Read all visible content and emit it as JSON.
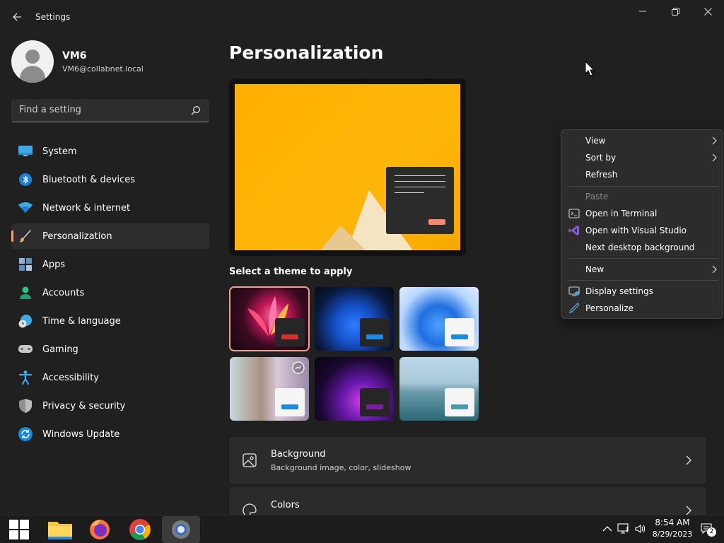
{
  "window": {
    "title": "Settings"
  },
  "profile": {
    "name": "VM6",
    "email": "VM6@collabnet.local"
  },
  "search": {
    "placeholder": "Find a setting"
  },
  "nav": {
    "items": [
      {
        "label": "System",
        "icon": "monitor-icon"
      },
      {
        "label": "Bluetooth & devices",
        "icon": "bluetooth-icon"
      },
      {
        "label": "Network & internet",
        "icon": "wifi-icon"
      },
      {
        "label": "Personalization",
        "icon": "paintbrush-icon"
      },
      {
        "label": "Apps",
        "icon": "apps-icon"
      },
      {
        "label": "Accounts",
        "icon": "person-icon"
      },
      {
        "label": "Time & language",
        "icon": "clock-globe-icon"
      },
      {
        "label": "Gaming",
        "icon": "gamepad-icon"
      },
      {
        "label": "Accessibility",
        "icon": "accessibility-icon"
      },
      {
        "label": "Privacy & security",
        "icon": "shield-icon"
      },
      {
        "label": "Windows Update",
        "icon": "update-icon"
      }
    ],
    "active_index": 3
  },
  "main": {
    "page_title": "Personalization",
    "theme_section_label": "Select a theme to apply",
    "cards": [
      {
        "title": "Background",
        "subtitle": "Background image, color, slideshow",
        "icon": "image-icon"
      },
      {
        "title": "Colors",
        "subtitle": "",
        "icon": "palette-icon"
      }
    ]
  },
  "context_menu": {
    "items": [
      {
        "label": "View",
        "has_submenu": true,
        "icon": ""
      },
      {
        "label": "Sort by",
        "has_submenu": true,
        "icon": ""
      },
      {
        "label": "Refresh",
        "has_submenu": false,
        "icon": ""
      },
      {
        "label": "Paste",
        "has_submenu": false,
        "disabled": true,
        "icon": ""
      },
      {
        "label": "Open in Terminal",
        "has_submenu": false,
        "icon": "terminal-icon"
      },
      {
        "label": "Open with Visual Studio",
        "has_submenu": false,
        "icon": "visual-studio-icon"
      },
      {
        "label": "Next desktop background",
        "has_submenu": false,
        "icon": ""
      },
      {
        "label": "New",
        "has_submenu": true,
        "icon": ""
      },
      {
        "label": "Display settings",
        "has_submenu": false,
        "icon": "display-settings-icon"
      },
      {
        "label": "Personalize",
        "has_submenu": false,
        "icon": "pen-icon"
      }
    ]
  },
  "taskbar": {
    "apps": [
      {
        "name": "start-button",
        "icon": "windows-logo-icon"
      },
      {
        "name": "file-explorer",
        "icon": "folder-icon"
      },
      {
        "name": "firefox",
        "icon": "firefox-icon"
      },
      {
        "name": "chrome",
        "icon": "chrome-icon"
      },
      {
        "name": "settings",
        "icon": "settings-gear-icon"
      }
    ],
    "clock": {
      "time": "8:54 AM",
      "date": "8/29/2023"
    },
    "notification_count": "2"
  },
  "colors": {
    "accent": "#f4a08a",
    "background": "#202020",
    "card": "#2b2b2b"
  }
}
